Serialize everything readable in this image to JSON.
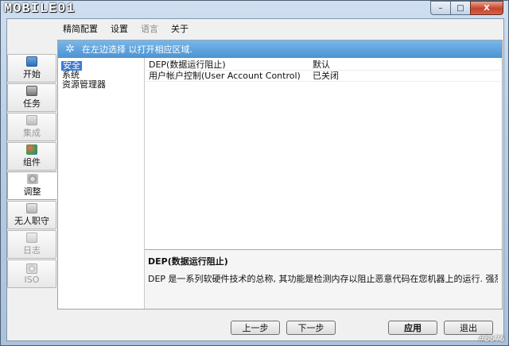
{
  "window": {
    "logo_text": "MOBILE01",
    "minimize": "–",
    "maximize": "□",
    "close": "X"
  },
  "menu": [
    "精简配置",
    "设置",
    "语言",
    "关于"
  ],
  "nav": [
    {
      "label": "开始",
      "icon": "start-icon",
      "state": "normal"
    },
    {
      "label": "任务",
      "icon": "task-icon",
      "state": "normal"
    },
    {
      "label": "集成",
      "icon": "integrate-icon",
      "state": "disabled"
    },
    {
      "label": "组件",
      "icon": "components-icon",
      "state": "normal"
    },
    {
      "label": "调整",
      "icon": "tweaks-icon",
      "state": "active"
    },
    {
      "label": "无人职守",
      "icon": "unattended-icon",
      "state": "normal"
    },
    {
      "label": "日志",
      "icon": "log-icon",
      "state": "disabled"
    },
    {
      "label": "ISO",
      "icon": "iso-icon",
      "state": "disabled"
    }
  ],
  "info_bar": {
    "text": "在左边选择 以打开相应区域."
  },
  "tree": [
    "安全",
    "系统",
    "资源管理器"
  ],
  "list": [
    {
      "name": "DEP(数据运行阻止)",
      "value": "默认"
    },
    {
      "name": "用户帐户控制(User Account Control)",
      "value": "已关闭"
    }
  ],
  "description": {
    "title": "DEP(数据运行阻止)",
    "text": "DEP 是一系列软硬件技术的总称, 其功能是检测内存以阻止恶意代码在您机器上的运行. 强烈建议..."
  },
  "buttons": {
    "prev": "上一步",
    "next": "下一步",
    "apply": "应用",
    "exit": "退出"
  },
  "watermark": "#5575"
}
